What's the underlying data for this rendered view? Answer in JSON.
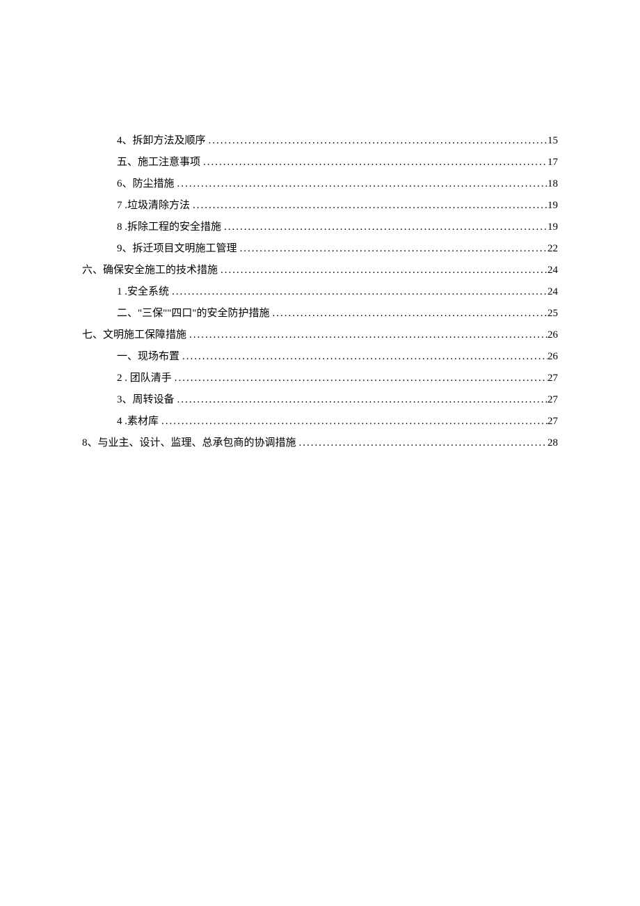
{
  "toc": {
    "entries": [
      {
        "level": 2,
        "label": "4、拆卸方法及顺序",
        "page": "15"
      },
      {
        "level": 2,
        "label": "五、施工注意事项",
        "page": "17"
      },
      {
        "level": 2,
        "label": "6、防尘措施",
        "page": "18"
      },
      {
        "level": 2,
        "label": "7  .垃圾清除方法",
        "page": "19"
      },
      {
        "level": 2,
        "label": "8  .拆除工程的安全措施",
        "page": "19"
      },
      {
        "level": 2,
        "label": "9、拆迁项目文明施工管理",
        "page": "22"
      },
      {
        "level": 1,
        "label": "六、确保安全施工的技术措施",
        "page": "24"
      },
      {
        "level": 2,
        "label": "1  .安全系统",
        "page": "24"
      },
      {
        "level": 2,
        "label": "二、\"三保\"\"四口\"的安全防护措施",
        "page": "25"
      },
      {
        "level": 1,
        "label": "七、文明施工保障措施",
        "page": "26"
      },
      {
        "level": 2,
        "label": "一、现场布置",
        "page": "26"
      },
      {
        "level": 2,
        "label": "2  . 团队清手",
        "page": "27"
      },
      {
        "level": 2,
        "label": "3、周转设备",
        "page": "27"
      },
      {
        "level": 2,
        "label": "4  .素材库",
        "page": "27"
      },
      {
        "level": 1,
        "label": "8、与业主、设计、监理、总承包商的协调措施",
        "page": "28"
      }
    ]
  }
}
